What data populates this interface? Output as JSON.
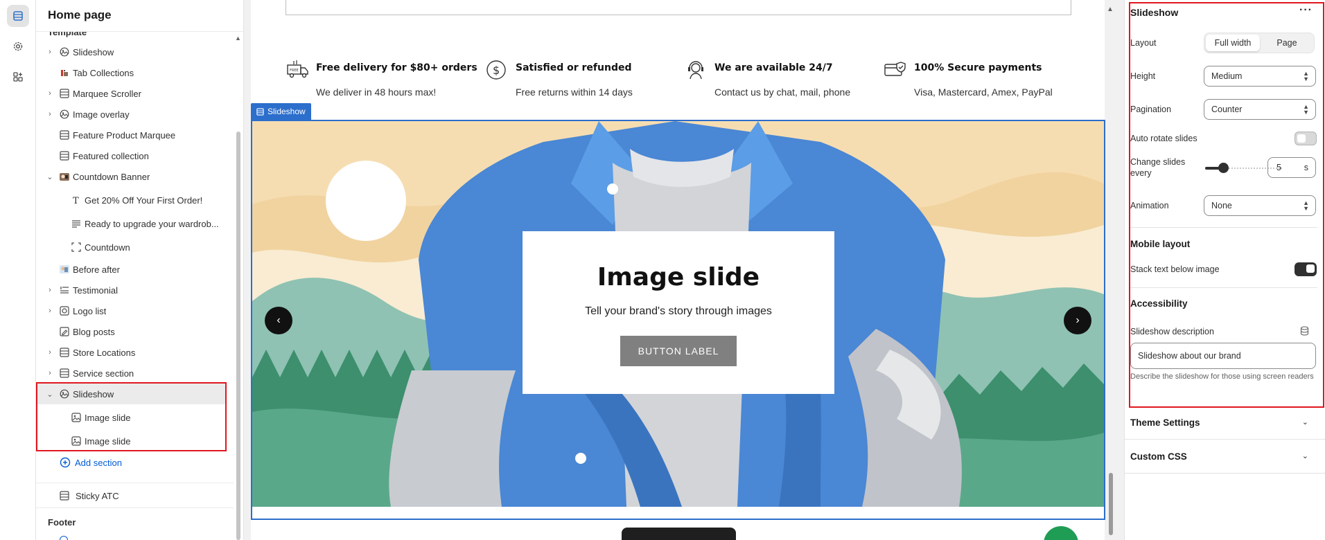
{
  "sidebar": {
    "title": "Home page",
    "partial_heading": "Template",
    "items": [
      {
        "label": "Slideshow",
        "icon": "slideshow-icon",
        "expandable": true
      },
      {
        "label": "Tab Collections",
        "icon": "tab-collections-icon",
        "expandable": false
      },
      {
        "label": "Marquee Scroller",
        "icon": "section-icon",
        "expandable": true
      },
      {
        "label": "Image overlay",
        "icon": "slideshow-icon",
        "expandable": true
      },
      {
        "label": "Feature Product Marquee",
        "icon": "section-icon",
        "expandable": false
      },
      {
        "label": "Featured collection",
        "icon": "section-icon",
        "expandable": false
      },
      {
        "label": "Countdown Banner",
        "icon": "countdown-banner-icon",
        "expandable": true,
        "expanded": true
      },
      {
        "label": "Get 20% Off Your First Order!",
        "icon": "text-icon",
        "child": true
      },
      {
        "label": "Ready to upgrade your wardrob...",
        "icon": "paragraph-icon",
        "child": true
      },
      {
        "label": "Countdown",
        "icon": "countdown-frame-icon",
        "child": true
      },
      {
        "label": "Before after",
        "icon": "before-after-icon",
        "expandable": false
      },
      {
        "label": "Testimonial",
        "icon": "testimonial-icon",
        "expandable": true
      },
      {
        "label": "Logo list",
        "icon": "logo-list-icon",
        "expandable": true
      },
      {
        "label": "Blog posts",
        "icon": "blog-icon",
        "expandable": false
      },
      {
        "label": "Store Locations",
        "icon": "section-icon",
        "expandable": true
      },
      {
        "label": "Service section",
        "icon": "section-icon",
        "expandable": true
      },
      {
        "label": "Slideshow",
        "icon": "slideshow-icon",
        "expandable": true,
        "expanded": true,
        "selected": true
      },
      {
        "label": "Image slide",
        "icon": "image-slide-icon",
        "child": true
      },
      {
        "label": "Image slide",
        "icon": "image-slide-icon",
        "child": true
      }
    ],
    "add_section_label": "Add section",
    "sticky_item": "Sticky ATC",
    "footer_heading": "Footer"
  },
  "preview": {
    "features": [
      {
        "title": "Free delivery for $80+ orders",
        "subtitle": "We deliver in 48 hours max!",
        "icon": "delivery-truck-icon"
      },
      {
        "title": "Satisfied or refunded",
        "subtitle": "Free returns within 14 days",
        "icon": "dollar-circle-icon"
      },
      {
        "title": "We are available 24/7",
        "subtitle": "Contact us by chat, mail, phone",
        "icon": "support-agent-icon"
      },
      {
        "title": "100% Secure payments",
        "subtitle": "Visa, Mastercard, Amex, PayPal",
        "icon": "secure-card-icon"
      }
    ],
    "section_tag": "Slideshow",
    "slide": {
      "heading": "Image slide",
      "subheading": "Tell your brand's story through images",
      "button": "BUTTON LABEL"
    }
  },
  "settings": {
    "title": "Slideshow",
    "layout": {
      "label": "Layout",
      "options": [
        "Full width",
        "Page"
      ],
      "selected": "Full width"
    },
    "height": {
      "label": "Height",
      "value": "Medium"
    },
    "pagination": {
      "label": "Pagination",
      "value": "Counter"
    },
    "auto_rotate": {
      "label": "Auto rotate slides",
      "on": false
    },
    "change_every": {
      "label_1": "Change slides",
      "label_2": "every",
      "value": "5",
      "unit": "s",
      "slider_fraction": 0.2
    },
    "animation": {
      "label": "Animation",
      "value": "None"
    },
    "mobile_heading": "Mobile layout",
    "stack_text": {
      "label": "Stack text below image",
      "on": true
    },
    "accessibility_heading": "Accessibility",
    "description": {
      "label": "Slideshow description",
      "value": "Slideshow about our brand",
      "helper": "Describe the slideshow for those using screen readers"
    },
    "collapsibles": [
      "Theme Settings",
      "Custom CSS"
    ]
  },
  "colors": {
    "accent_blue": "#2c6ecb",
    "highlight_red": "#e0161e",
    "link_blue": "#005bd3",
    "fab_green": "#1f9d55"
  }
}
